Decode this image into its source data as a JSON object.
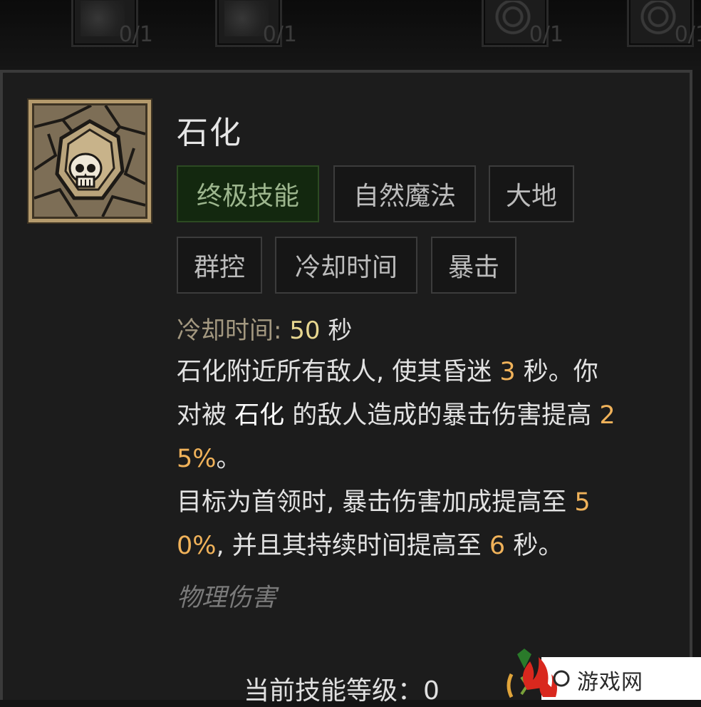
{
  "top_slots": [
    {
      "icon": "beast-skill-icon",
      "rank": "0/1"
    },
    {
      "icon": "beast-skill-icon",
      "rank": "0/1"
    },
    {
      "icon": "vine-swirl-skill-icon",
      "rank": "0/1"
    },
    {
      "icon": "vine-swirl-skill-icon",
      "rank": "0/1"
    }
  ],
  "skill": {
    "icon": "petrify-skull-crystal-icon",
    "name": "石化",
    "tags_row1": [
      "终极技能",
      "自然魔法",
      "大地"
    ],
    "tags_row2": [
      "群控",
      "冷却时间",
      "暴击"
    ],
    "cooldown_label": "冷却时间:",
    "cooldown_value": "50",
    "cooldown_unit": "秒",
    "desc": {
      "l1_a": "石化附近所有敌人, 使其昏迷 ",
      "l1_num": "3",
      "l1_b": " 秒。你",
      "l2_a": "对被 ",
      "l2_hl": "石化",
      "l2_b": " 的敌人造成的暴击伤害提高 ",
      "l2_num": "2",
      "l3_num": "5%",
      "l3_b": "。",
      "l4_a": "目标为首领时, 暴击伤害加成提高至 ",
      "l4_num": "5",
      "l5_num": "0%",
      "l5_b": ", 并且其持续时间提高至 ",
      "l5_num2": "6",
      "l5_c": " 秒。"
    },
    "damage_type": "物理伤害",
    "level_label": "当前技能等级：0"
  },
  "colors": {
    "number_highlight": "#f0b25a",
    "cooldown_value": "#e8d790",
    "ultimate_tag_bg": "#13280f",
    "icon_frame": "#b49a6c"
  },
  "watermark": {
    "text": "游戏网",
    "logo_icon": "ae-logo-icon"
  }
}
